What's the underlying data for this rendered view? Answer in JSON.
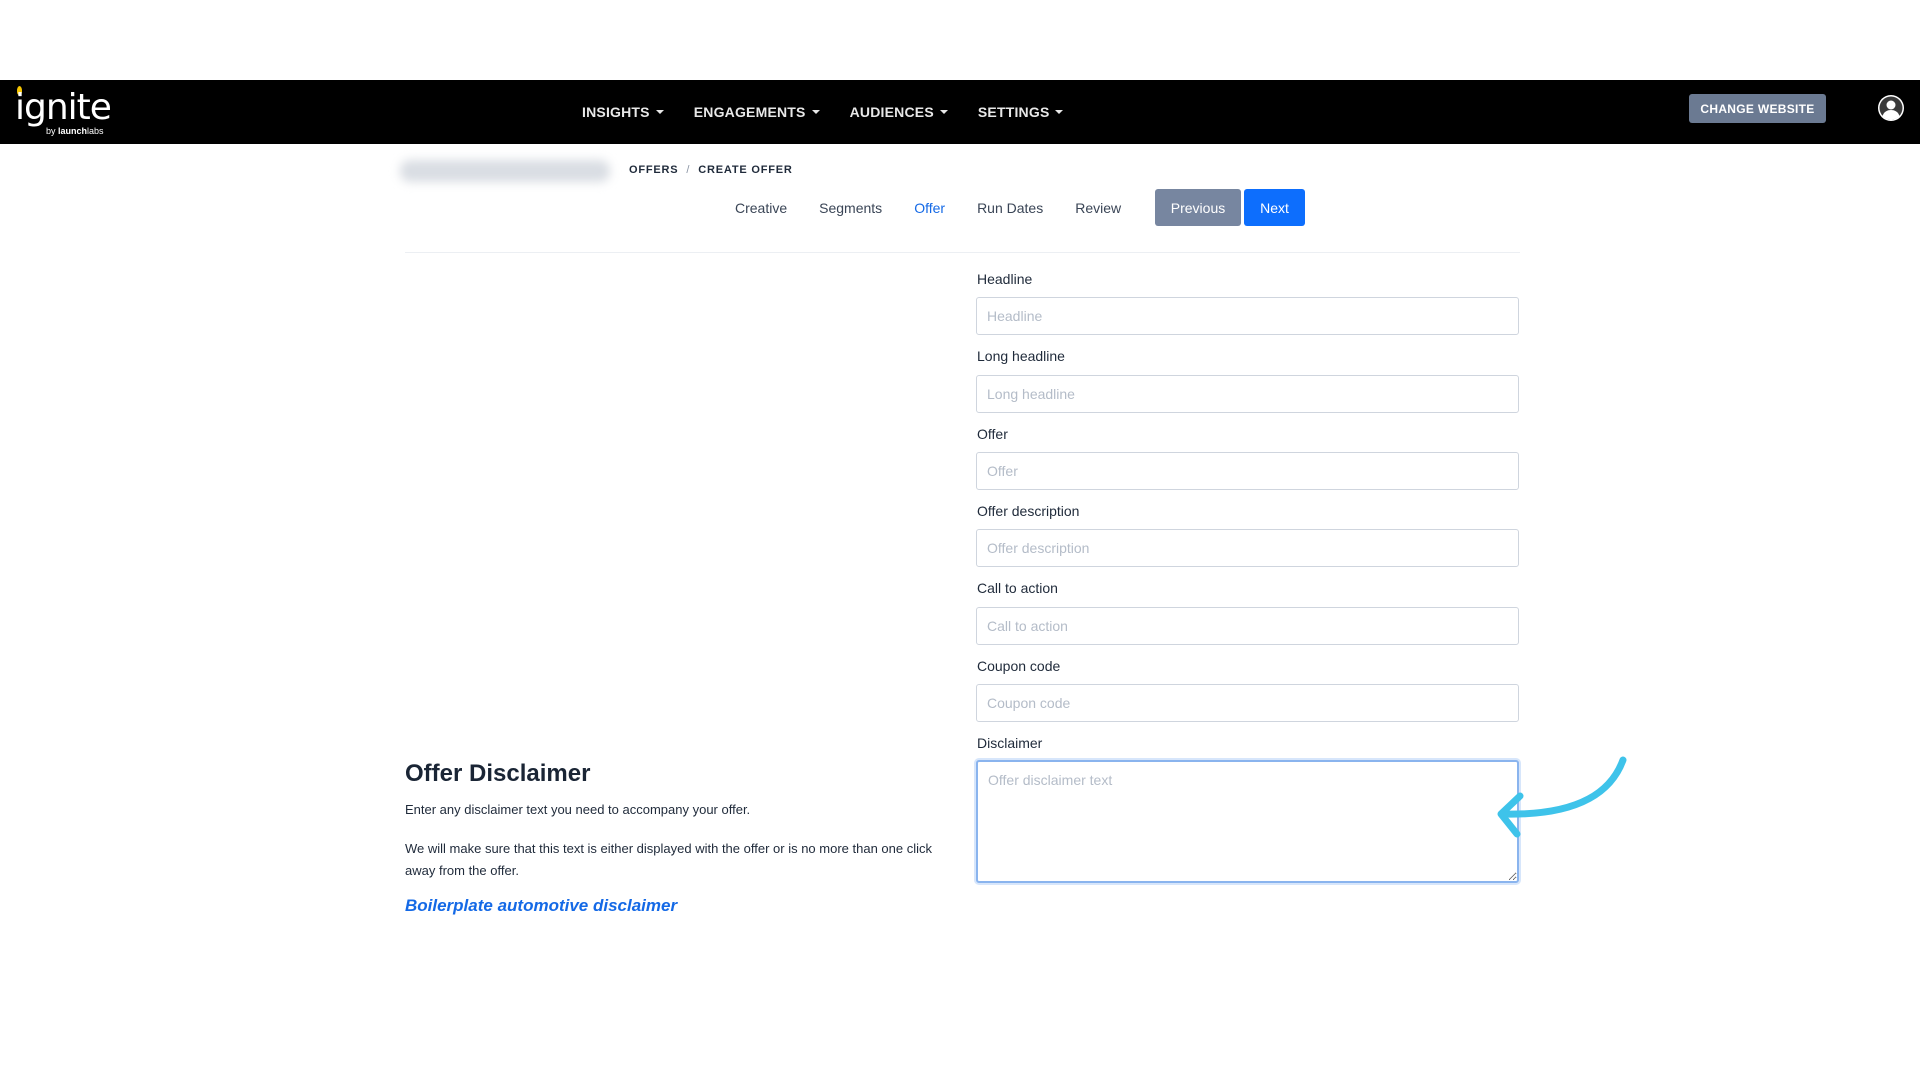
{
  "brand": {
    "logo_text": "ignite",
    "logo_sub_prefix": "by ",
    "logo_sub_brand": "launch",
    "logo_sub_suffix": "labs"
  },
  "nav": {
    "items": [
      {
        "label": "INSIGHTS"
      },
      {
        "label": "ENGAGEMENTS"
      },
      {
        "label": "AUDIENCES"
      },
      {
        "label": "SETTINGS"
      }
    ],
    "change_website": "CHANGE WEBSITE",
    "avatar_icon": "user-circle-icon"
  },
  "breadcrumb": {
    "items": [
      "OFFERS",
      "CREATE OFFER"
    ],
    "separator": "/"
  },
  "steps": [
    {
      "label": "Creative",
      "active": false
    },
    {
      "label": "Segments",
      "active": false
    },
    {
      "label": "Offer",
      "active": true
    },
    {
      "label": "Run Dates",
      "active": false
    },
    {
      "label": "Review",
      "active": false
    }
  ],
  "buttons": {
    "previous": "Previous",
    "next": "Next"
  },
  "form": {
    "headline": {
      "label": "Headline",
      "placeholder": "Headline",
      "value": ""
    },
    "long_headline": {
      "label": "Long headline",
      "placeholder": "Long headline",
      "value": ""
    },
    "offer": {
      "label": "Offer",
      "placeholder": "Offer",
      "value": ""
    },
    "offer_description": {
      "label": "Offer description",
      "placeholder": "Offer description",
      "value": ""
    },
    "call_to_action": {
      "label": "Call to action",
      "placeholder": "Call to action",
      "value": ""
    },
    "coupon_code": {
      "label": "Coupon code",
      "placeholder": "Coupon code",
      "value": ""
    },
    "disclaimer": {
      "label": "Disclaimer",
      "placeholder": "Offer disclaimer text",
      "value": ""
    }
  },
  "disclaimer_info": {
    "title": "Offer Disclaimer",
    "p1": "Enter any disclaimer text you need to accompany your offer.",
    "p2": "We will make sure that this text is either displayed with the offer or is no more than one click away from the offer.",
    "link": "Boilerplate automotive disclaimer"
  },
  "colors": {
    "nav_bg": "#000000",
    "accent": "#0d6efd",
    "secondary_button": "#7786a0",
    "annotation_arrow": "#3ec3ea"
  }
}
